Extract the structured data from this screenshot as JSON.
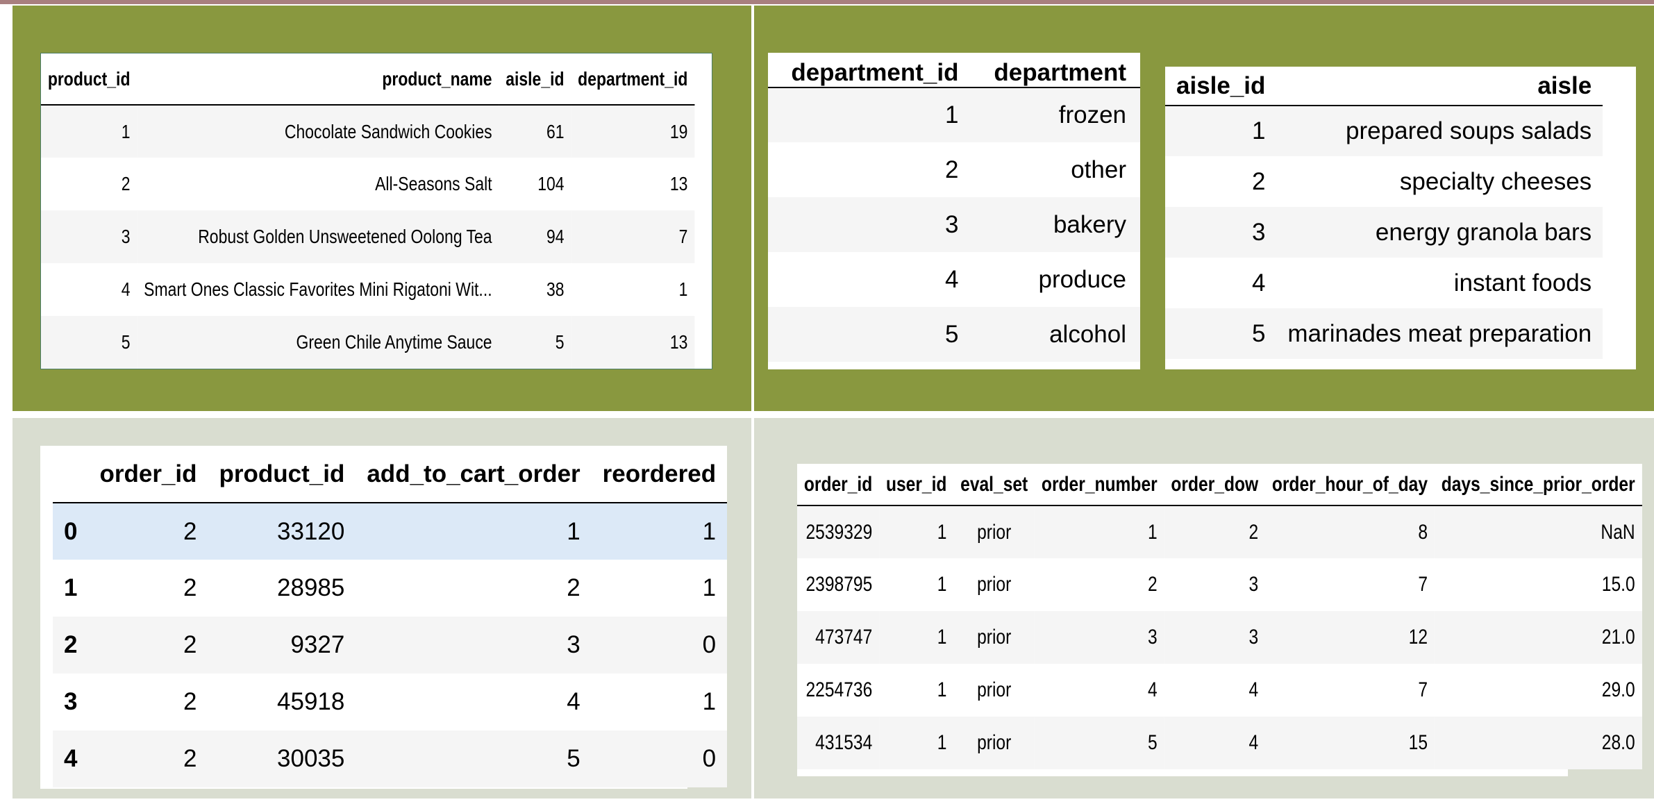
{
  "products": {
    "columns": [
      "product_id",
      "product_name",
      "aisle_id",
      "department_id"
    ],
    "rows": [
      [
        "1",
        "Chocolate Sandwich Cookies",
        "61",
        "19"
      ],
      [
        "2",
        "All-Seasons Salt",
        "104",
        "13"
      ],
      [
        "3",
        "Robust Golden Unsweetened Oolong Tea",
        "94",
        "7"
      ],
      [
        "4",
        "Smart Ones Classic Favorites Mini Rigatoni Wit...",
        "38",
        "1"
      ],
      [
        "5",
        "Green Chile Anytime Sauce",
        "5",
        "13"
      ]
    ]
  },
  "departments": {
    "columns": [
      "department_id",
      "department"
    ],
    "rows": [
      [
        "1",
        "frozen"
      ],
      [
        "2",
        "other"
      ],
      [
        "3",
        "bakery"
      ],
      [
        "4",
        "produce"
      ],
      [
        "5",
        "alcohol"
      ]
    ]
  },
  "aisles": {
    "columns": [
      "aisle_id",
      "aisle"
    ],
    "rows": [
      [
        "1",
        "prepared soups salads"
      ],
      [
        "2",
        "specialty cheeses"
      ],
      [
        "3",
        "energy granola bars"
      ],
      [
        "4",
        "instant foods"
      ],
      [
        "5",
        "marinades meat preparation"
      ]
    ]
  },
  "order_products": {
    "columns": [
      "",
      "order_id",
      "product_id",
      "add_to_cart_order",
      "reordered"
    ],
    "rows": [
      [
        "0",
        "2",
        "33120",
        "1",
        "1"
      ],
      [
        "1",
        "2",
        "28985",
        "2",
        "1"
      ],
      [
        "2",
        "2",
        "9327",
        "3",
        "0"
      ],
      [
        "3",
        "2",
        "45918",
        "4",
        "1"
      ],
      [
        "4",
        "2",
        "30035",
        "5",
        "0"
      ]
    ]
  },
  "orders": {
    "columns": [
      "order_id",
      "user_id",
      "eval_set",
      "order_number",
      "order_dow",
      "order_hour_of_day",
      "days_since_prior_order"
    ],
    "rows": [
      [
        "2539329",
        "1",
        "prior",
        "1",
        "2",
        "8",
        "NaN"
      ],
      [
        "2398795",
        "1",
        "prior",
        "2",
        "3",
        "7",
        "15.0"
      ],
      [
        "473747",
        "1",
        "prior",
        "3",
        "3",
        "12",
        "21.0"
      ],
      [
        "2254736",
        "1",
        "prior",
        "4",
        "4",
        "7",
        "29.0"
      ],
      [
        "431534",
        "1",
        "prior",
        "5",
        "4",
        "15",
        "28.0"
      ]
    ]
  },
  "colors": {
    "top_panel_bg": "#89983f",
    "bottom_panel_bg": "#d9ddd0",
    "highlight_row": "#dce9f7",
    "stripe_row": "#f5f5f5"
  }
}
